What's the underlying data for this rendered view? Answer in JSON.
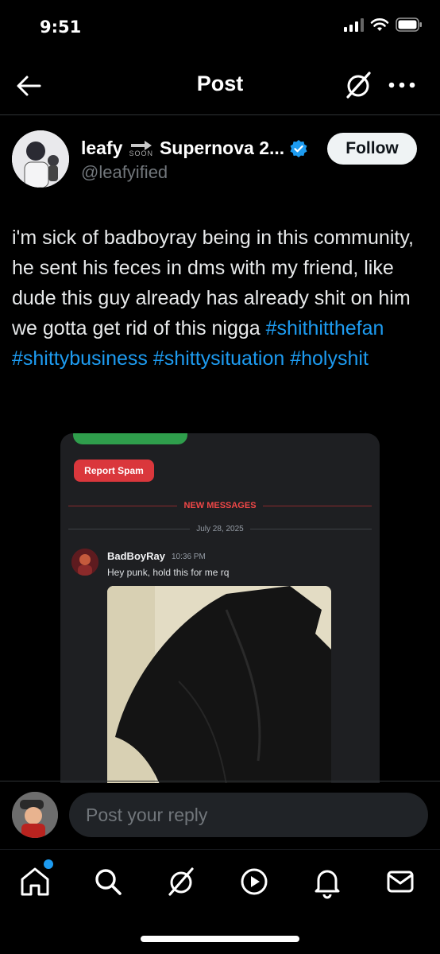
{
  "status_bar": {
    "time": "9:51"
  },
  "header": {
    "title": "Post"
  },
  "author": {
    "name_left": "leafy",
    "soon_label": "SOON",
    "name_right": "Supernova 2...",
    "handle": "@leafyified"
  },
  "follow_label": "Follow",
  "post": {
    "text_parts": [
      "i'm sick of badboyray being in this community, he sent his feces in dms with my friend, like dude this guy already has already shit on him we gotta get rid of this nigga "
    ],
    "hashtags": [
      "#shithitthefan",
      "#shittybusiness",
      "#shittysituation",
      "#holyshit"
    ]
  },
  "embedded_screenshot": {
    "report_spam": "Report Spam",
    "new_messages": "NEW MESSAGES",
    "date": "July 28, 2025",
    "message": {
      "author": "BadBoyRay",
      "time": "10:36 PM",
      "text": "Hey punk, hold this for me rq"
    }
  },
  "reply": {
    "placeholder": "Post your reply"
  },
  "colors": {
    "accent": "#1d9bf0",
    "report": "#da373c",
    "new_messages": "#f04747"
  },
  "nav_icons": [
    "home-icon",
    "search-icon",
    "grok-icon",
    "video-icon",
    "bell-icon",
    "mail-icon"
  ]
}
